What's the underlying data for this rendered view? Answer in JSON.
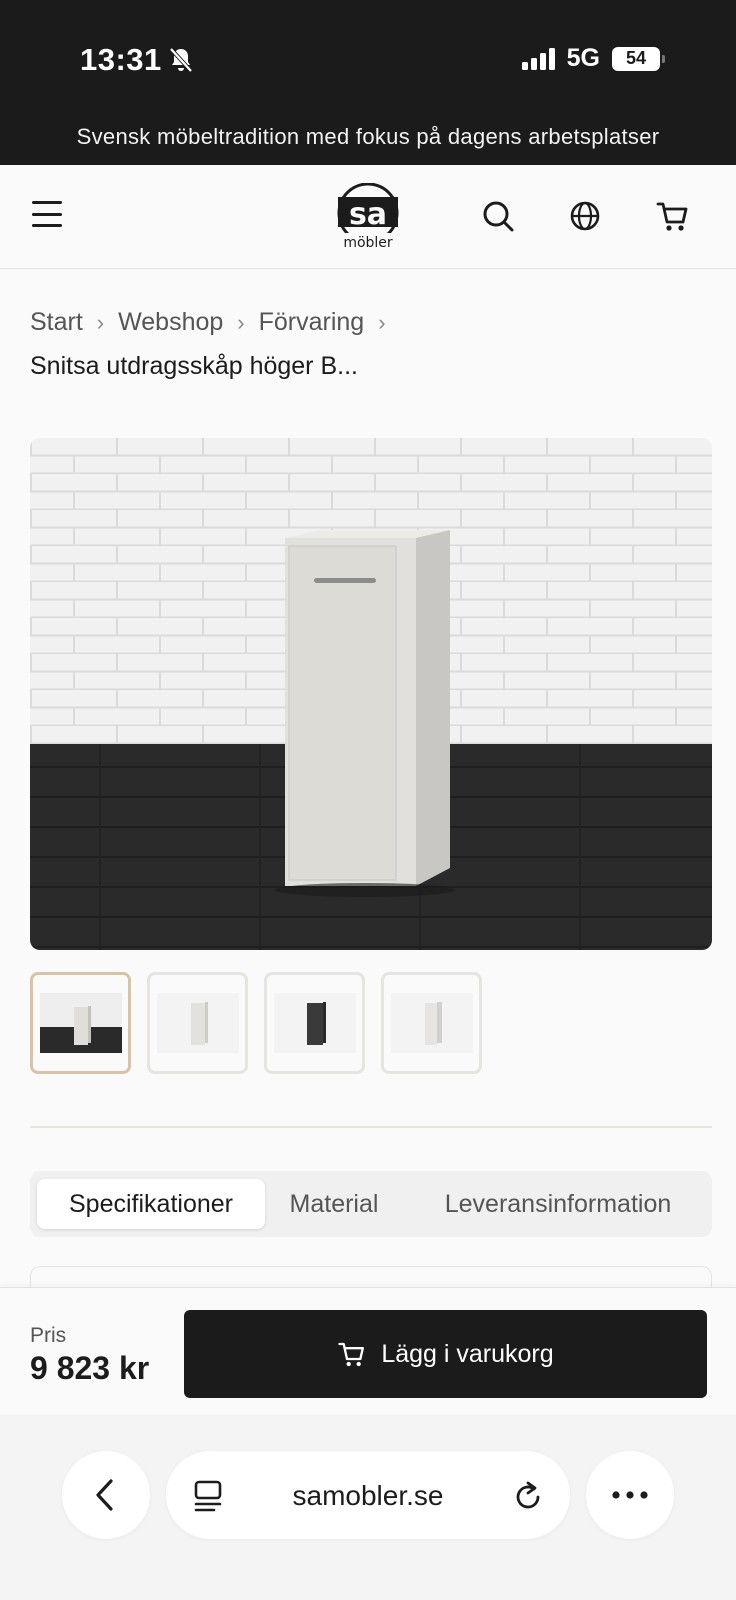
{
  "status_bar": {
    "time": "13:31",
    "network": "5G",
    "battery": "54"
  },
  "promo": {
    "text": "Svensk möbeltradition med fokus på dagens arbetsplatser"
  },
  "header": {
    "logo_text": "sa",
    "logo_subtext": "möbler"
  },
  "breadcrumb": {
    "items": [
      "Start",
      "Webshop",
      "Förvaring"
    ],
    "separator": "›",
    "current": "Snitsa utdragsskåp höger B..."
  },
  "gallery": {
    "thumbnails": [
      {
        "variant": "white-on-dark-floor",
        "active": true
      },
      {
        "variant": "white",
        "active": false
      },
      {
        "variant": "black",
        "active": false
      },
      {
        "variant": "white-side",
        "active": false
      }
    ]
  },
  "tabs": [
    "Specifikationer",
    "Material",
    "Leveransinformation"
  ],
  "price": {
    "label": "Pris",
    "value": "9 823 kr"
  },
  "cart_button": {
    "label": "Lägg i varukorg"
  },
  "browser": {
    "url": "samobler.se"
  },
  "icons": {
    "menu": "menu-icon",
    "search": "search-icon",
    "language": "globe-icon",
    "cart": "cart-icon",
    "back": "chevron-left-icon",
    "tabs": "tabs-icon",
    "reload": "reload-icon",
    "more": "more-icon",
    "silent": "bell-slash-icon"
  },
  "colors": {
    "dark": "#1b1b1b",
    "accent_border": "#d9c3a6",
    "background": "#fafafa"
  }
}
